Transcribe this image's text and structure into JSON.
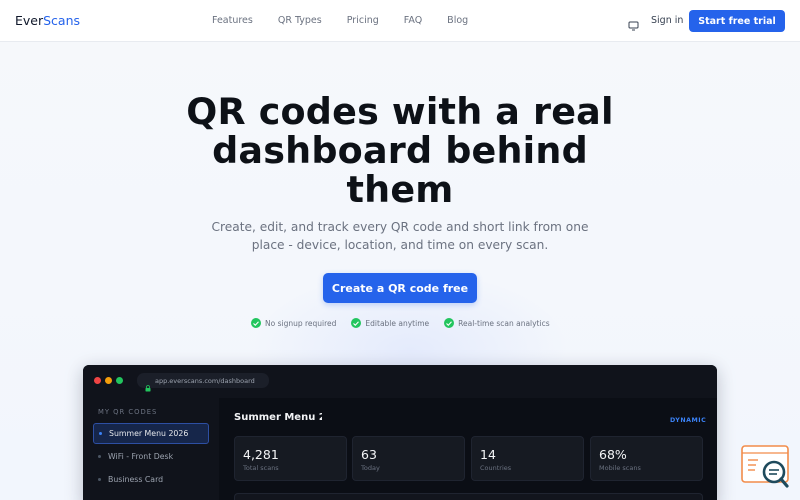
{
  "nav": {
    "logo_a": "Ever",
    "logo_b": "Scans",
    "links": [
      "Features",
      "QR Types",
      "Pricing",
      "FAQ",
      "Blog"
    ],
    "signin": "Sign in",
    "cta": "Start free trial"
  },
  "hero": {
    "title_line1": "QR codes with a real",
    "title_line2": "dashboard behind",
    "title_line3": "them",
    "subtitle_line1": "Create, edit, and track every QR code and short link from one",
    "subtitle_line2": "place - device, location, and time on every scan.",
    "cta": "Create a QR code free",
    "checks": [
      "No signup required",
      "Editable anytime",
      "Real-time scan analytics"
    ]
  },
  "app": {
    "url": "app.everscans.com/dashboard",
    "sidebar_title": "MY QR CODES",
    "sidebar_items": [
      "Summer Menu 2026",
      "WiFi - Front Desk",
      "Business Card"
    ],
    "main_title": "Summer Menu 2026",
    "badge": "DYNAMIC",
    "stats": [
      {
        "value": "4,281",
        "label": "Total scans"
      },
      {
        "value": "63",
        "label": "Today"
      },
      {
        "value": "14",
        "label": "Countries"
      },
      {
        "value": "68%",
        "label": "Mobile scans"
      }
    ]
  },
  "colors": {
    "accent": "#2563eb",
    "check": "#22c55e",
    "dark_bg": "#0b0e15"
  },
  "icons": {
    "monitor": "monitor-icon",
    "lock": "lock-icon",
    "check": "check-icon",
    "search_widget": "search-chat-icon"
  }
}
